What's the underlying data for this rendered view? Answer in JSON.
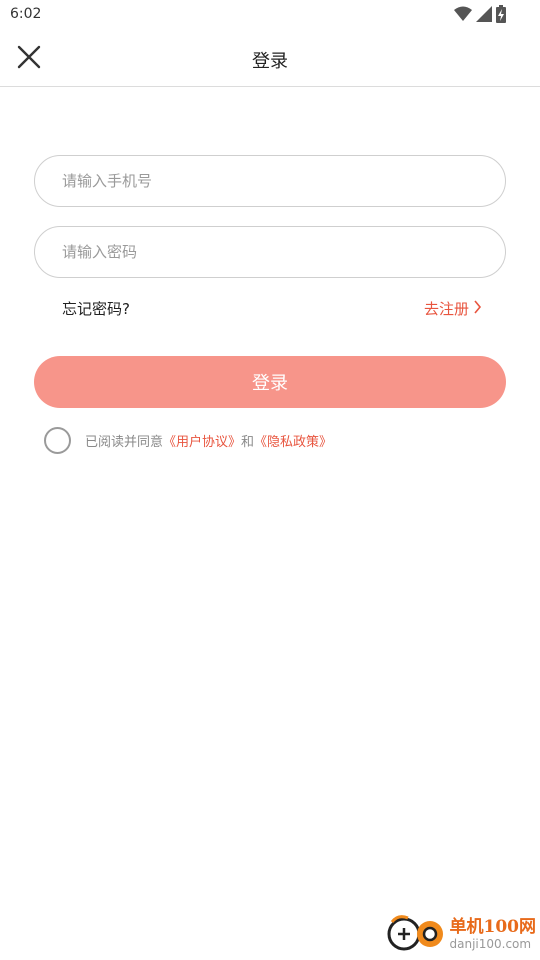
{
  "status_bar": {
    "time": "6:02",
    "icons": [
      "wifi-icon",
      "signal-icon",
      "battery-charging-icon"
    ]
  },
  "header": {
    "title": "登录",
    "close_icon": "close-icon"
  },
  "form": {
    "phone_placeholder": "请输入手机号",
    "phone_value": "",
    "password_placeholder": "请输入密码",
    "password_value": "",
    "forgot_label": "忘记密码?",
    "register_label": "去注册",
    "login_label": "登录"
  },
  "agreement": {
    "checked": false,
    "prefix": "已阅读并同意",
    "user_agreement": "《用户协议》",
    "joiner": "和",
    "privacy_policy": "《隐私政策》"
  },
  "watermark": {
    "line1": "单机100网",
    "line2": "danji100.com"
  },
  "colors": {
    "accent": "#e8553f",
    "button": "#f7958a",
    "border": "#cfcfcf"
  }
}
